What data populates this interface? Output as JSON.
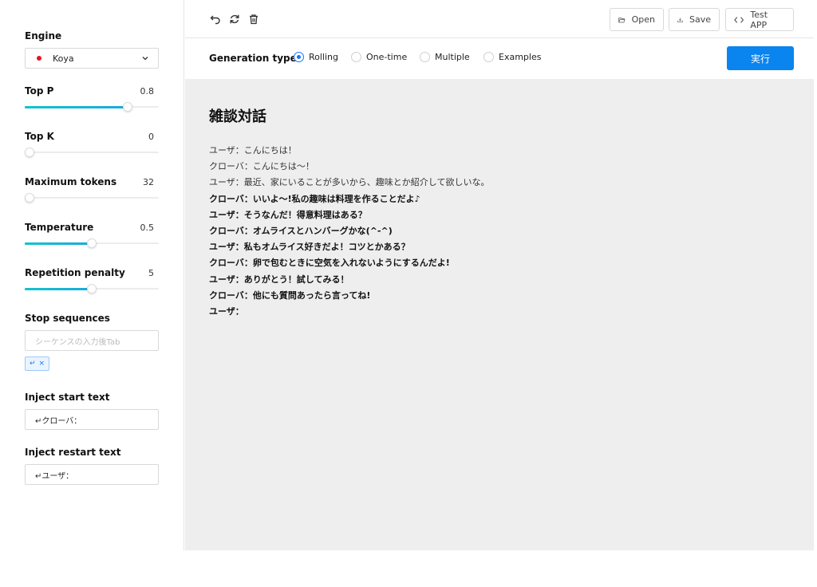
{
  "sidebar": {
    "engine": {
      "label": "Engine",
      "value": "Koya",
      "dot_color": "#e8112d"
    },
    "top_p": {
      "label": "Top P",
      "value": "0.8",
      "level": 0.77
    },
    "top_k": {
      "label": "Top K",
      "value": "0",
      "level": 0.0
    },
    "max_tokens": {
      "label": "Maximum tokens",
      "value": "32",
      "level": 0.02
    },
    "temperature": {
      "label": "Temperature",
      "value": "0.5",
      "level": 0.5
    },
    "repetition_penalty": {
      "label": "Repetition penalty",
      "value": "5",
      "level": 0.5
    },
    "stop_sequences": {
      "label": "Stop sequences",
      "placeholder": "シーケンスの入力後Tab",
      "tag": "↵",
      "tag_close": "×"
    },
    "inject_start": {
      "label": "Inject start text",
      "value": "↵クローバ："
    },
    "inject_restart": {
      "label": "Inject restart text",
      "value": "↵ユーザ："
    }
  },
  "toolbar": {
    "icons": [
      "undo-icon",
      "refresh-icon",
      "trash-icon"
    ],
    "open_label": "Open",
    "save_label": "Save",
    "test_label": "Test APP"
  },
  "generation": {
    "label": "Generation type",
    "options": [
      "Rolling",
      "One-time",
      "Multiple",
      "Examples"
    ],
    "selected": "Rolling",
    "run_label": "実行",
    "accent": "#0a84ef"
  },
  "content": {
    "title": "雑談対話",
    "lines": [
      "ユーザ：こんにちは！",
      "クローバ：こんにちは～！",
      "ユーザ：最近、家にいることが多いから、趣味とか紹介して欲しいな。",
      "クローバ：いいよ～!私の趣味は料理を作ることだよ♪",
      "ユーザ：そうなんだ！得意料理はある？",
      "クローバ：オムライスとハンバーグかな(^-^)",
      "ユーザ：私もオムライス好きだよ！コツとかある？",
      "クローバ：卵で包むときに空気を入れないようにするんだよ!",
      "ユーザ：ありがとう！試してみる！",
      "クローバ：他にも質問あったら言ってね!",
      "ユーザ："
    ]
  }
}
